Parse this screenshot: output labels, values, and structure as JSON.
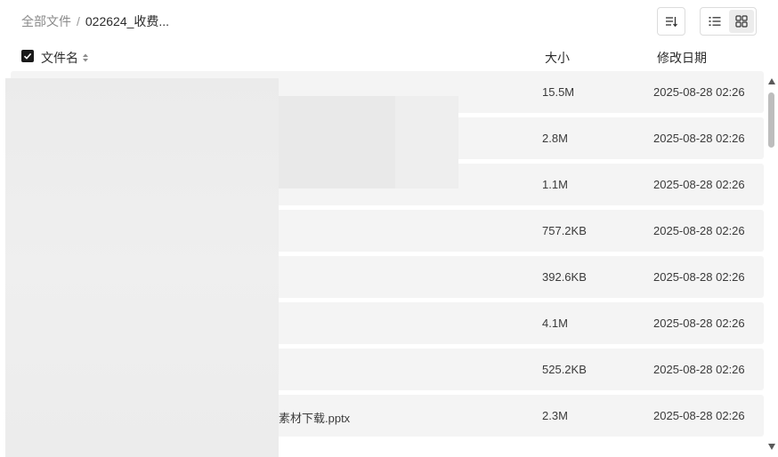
{
  "breadcrumb": {
    "root": "全部文件",
    "separator": "/",
    "current": "022624_收费..."
  },
  "toolbar": {
    "sort_icon": "sort-icon",
    "list_icon": "list-view-icon",
    "grid_icon": "grid-view-icon"
  },
  "table": {
    "header": {
      "name": "文件名",
      "size": "大小",
      "date": "修改日期"
    },
    "rows": [
      {
        "name": "",
        "size": "15.5M",
        "date": "2025-08-28 02:26"
      },
      {
        "name": "",
        "size": "2.8M",
        "date": "2025-08-28 02:26"
      },
      {
        "name": "",
        "size": "1.1M",
        "date": "2025-08-28 02:26"
      },
      {
        "name": "",
        "size": "757.2KB",
        "date": "2025-08-28 02:26"
      },
      {
        "name": "",
        "size": "392.6KB",
        "date": "2025-08-28 02:26"
      },
      {
        "name": "",
        "size": "4.1M",
        "date": "2025-08-28 02:26"
      },
      {
        "name": "",
        "size": "525.2KB",
        "date": "2025-08-28 02:26"
      },
      {
        "name": "素材下载.pptx",
        "size": "2.3M",
        "date": "2025-08-28 02:26"
      }
    ]
  },
  "colors": {
    "accent_check": "#1a1a1a",
    "row_bg": "#f4f4f4"
  }
}
